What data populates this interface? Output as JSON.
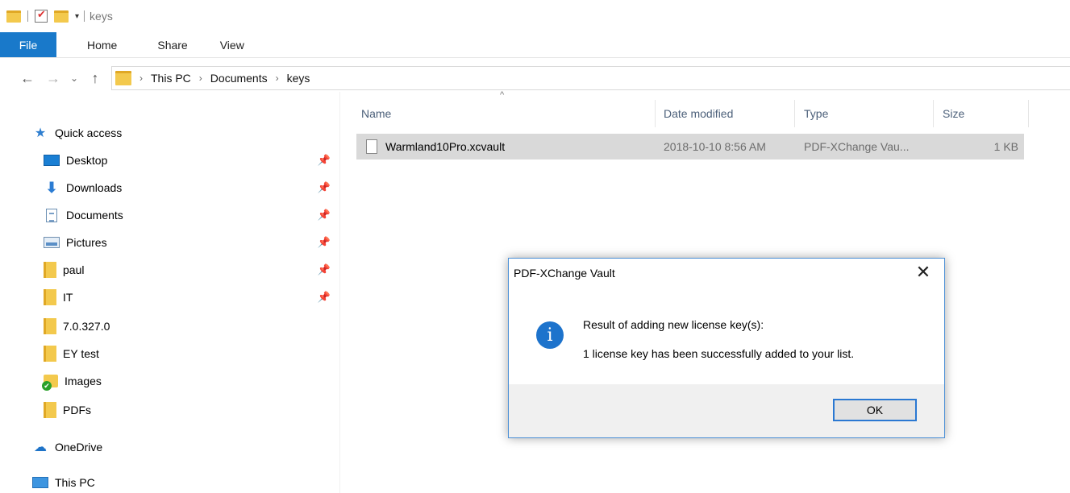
{
  "window": {
    "title": "keys"
  },
  "ribbon": {
    "tabs": [
      "File",
      "Home",
      "Share",
      "View"
    ]
  },
  "address": {
    "crumbs": [
      "This PC",
      "Documents",
      "keys"
    ]
  },
  "sidebar": {
    "quick_access": "Quick access",
    "items": [
      {
        "label": "Desktop",
        "icon": "desktop-icon",
        "pinned": true
      },
      {
        "label": "Downloads",
        "icon": "downloads-icon",
        "pinned": true
      },
      {
        "label": "Documents",
        "icon": "documents-icon",
        "pinned": true
      },
      {
        "label": "Pictures",
        "icon": "pictures-icon",
        "pinned": true
      },
      {
        "label": "paul",
        "icon": "folder-icon",
        "pinned": true
      },
      {
        "label": "IT",
        "icon": "folder-icon",
        "pinned": true
      },
      {
        "label": "7.0.327.0",
        "icon": "folder-icon",
        "pinned": false
      },
      {
        "label": "EY test",
        "icon": "folder-icon",
        "pinned": false
      },
      {
        "label": "Images",
        "icon": "images-folder-icon",
        "pinned": false
      },
      {
        "label": "PDFs",
        "icon": "folder-icon",
        "pinned": false
      }
    ],
    "onedrive": "OneDrive",
    "this_pc": "This PC"
  },
  "file_list": {
    "columns": {
      "name": "Name",
      "date": "Date modified",
      "type": "Type",
      "size": "Size"
    },
    "rows": [
      {
        "name": "Warmland10Pro.xcvault",
        "date": "2018-10-10 8:56 AM",
        "type": "PDF-XChange Vau...",
        "size": "1 KB"
      }
    ]
  },
  "dialog": {
    "title": "PDF-XChange Vault",
    "message_heading": "Result of adding new license key(s):",
    "message_body": "1 license key has been successfully added to your list.",
    "ok_label": "OK"
  }
}
